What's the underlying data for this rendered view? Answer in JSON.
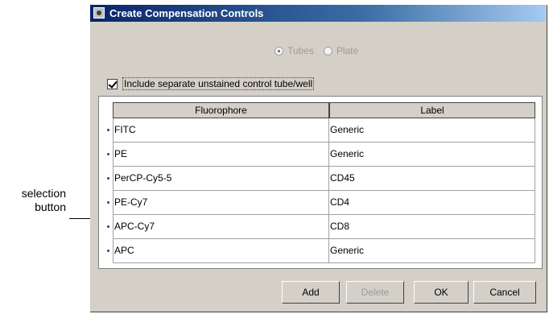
{
  "callout": {
    "line1": "selection",
    "line2": "button"
  },
  "window": {
    "title": "Create Compensation Controls"
  },
  "mode": {
    "options": [
      {
        "label": "Tubes",
        "selected": true
      },
      {
        "label": "Plate",
        "selected": false
      }
    ]
  },
  "unstained": {
    "label": "Include separate unstained control tube/well",
    "checked": true
  },
  "table": {
    "headers": [
      "Fluorophore",
      "Label"
    ],
    "rows": [
      {
        "fluorophore": "FITC",
        "label": "Generic"
      },
      {
        "fluorophore": "PE",
        "label": "Generic"
      },
      {
        "fluorophore": "PerCP-Cy5-5",
        "label": "CD45"
      },
      {
        "fluorophore": "PE-Cy7",
        "label": "CD4"
      },
      {
        "fluorophore": "APC-Cy7",
        "label": "CD8"
      },
      {
        "fluorophore": "APC",
        "label": "Generic"
      }
    ]
  },
  "buttons": {
    "add": "Add",
    "delete": "Delete",
    "ok": "OK",
    "cancel": "Cancel"
  },
  "colors": {
    "title_bar_start": "#0a246a",
    "dialog_face": "#d4d0c8"
  }
}
